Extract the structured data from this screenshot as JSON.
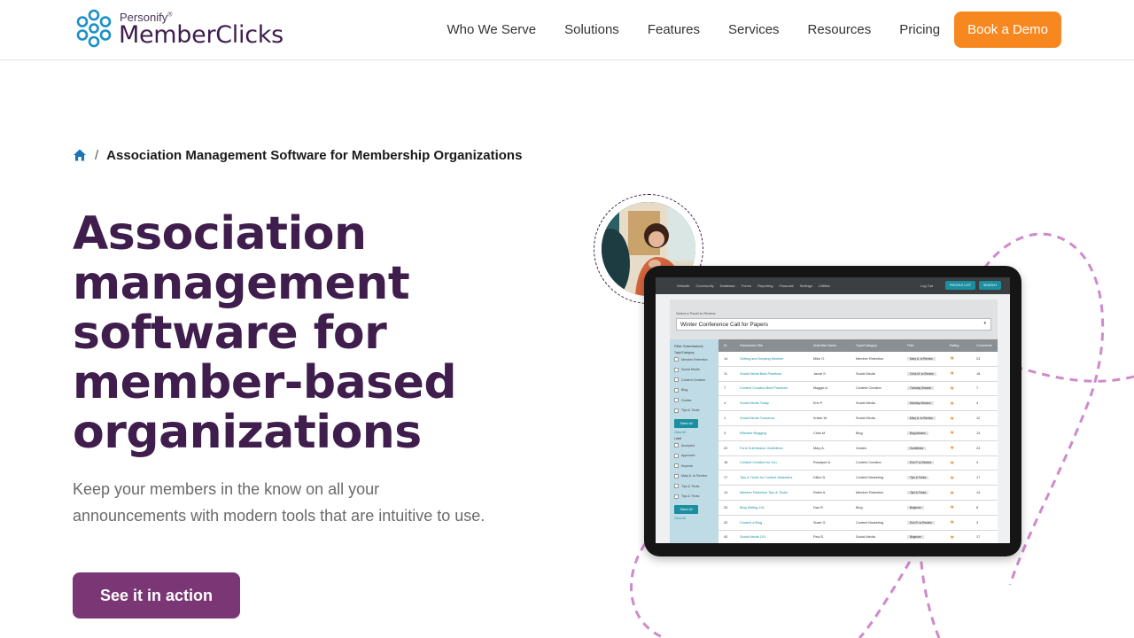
{
  "header": {
    "logo": {
      "small": "Personify",
      "mark": "®",
      "big": "MemberClicks"
    },
    "nav": [
      "Who We Serve",
      "Solutions",
      "Features",
      "Services",
      "Resources",
      "Pricing"
    ],
    "demo_label": "Book a Demo"
  },
  "breadcrumb": {
    "separator": "/",
    "current": "Association Management Software for Membership Organizations"
  },
  "hero": {
    "title_lines": [
      "Association",
      "management",
      "software for",
      "member-based",
      "organizations"
    ],
    "subtitle": "Keep your members in the know on all your announcements with modern tools that are intuitive to use.",
    "cta_label": "See it in action"
  },
  "tablet": {
    "topnav": [
      "Website",
      "Community",
      "Database",
      "Forms",
      "Reporting",
      "Financial",
      "Settings",
      "Utilities"
    ],
    "logout": "Log Out",
    "btn1": "PROFILE LIST",
    "btn2": "SEARCH",
    "select_label": "Select a Panel to Review",
    "select_value": "Winter Conference Call for Papers",
    "filter_head": "Filter Submissions",
    "filter_sub1": "Topic/Category",
    "filters1": [
      "Member Retention",
      "Social Media",
      "Content Creation",
      "Blog",
      "Guides",
      "Tips & Tricks"
    ],
    "select_all": "Select All",
    "clear_all": "Clear All",
    "filter_sub2": "Label",
    "filters2": [
      "Accepted",
      "Approved",
      "Keynote",
      "Mary A. to Review",
      "Tips & Tricks",
      "Tips & Tricks"
    ],
    "columns": [
      "ID",
      "Submission Title",
      "Submitter Name",
      "Topic/Category",
      "Filter",
      "Rating",
      "Comments"
    ],
    "rows": [
      [
        "14",
        "Getting and Keeping Member",
        "Mike O.",
        "Member Retention",
        "Mary A. to Review",
        "★",
        "23"
      ],
      [
        "11",
        "Social Media Best Practices",
        "Jacob S.",
        "Social Media",
        "Chris M. to Review",
        "★",
        "18"
      ],
      [
        "7",
        "Content Creation Best Practices",
        "Maggie A.",
        "Content Creation",
        "Tuesday Session",
        "★",
        "7"
      ],
      [
        "4",
        "Social Media Today",
        "Erin P.",
        "Social Media",
        "Monday Session",
        "★",
        "4"
      ],
      [
        "1",
        "Social Media Tomorrow",
        "Kristin W.",
        "Social Media",
        "Mary A. to Review",
        "★",
        "12"
      ],
      [
        "3",
        "Effective Blogging",
        "Chris M.",
        "Blog",
        "Blog Articles",
        "★",
        "13"
      ],
      [
        "22",
        "Form Submission Guidelines",
        "Mary A.",
        "Guides",
        "Guidelines",
        "★",
        "24"
      ],
      [
        "18",
        "Content Creation for You",
        "Rosalyce A.",
        "Content Creation",
        "Erin P. to Review",
        "★",
        "4"
      ],
      [
        "17",
        "Tips & Tricks for Content Marketers",
        "Dillon D.",
        "Content Marketing",
        "Tips & Tricks",
        "★",
        "17"
      ],
      [
        "14",
        "Member Retention Tips & Tricks",
        "Robin A.",
        "Member Retention",
        "Tips & Tricks",
        "★",
        "14"
      ],
      [
        "33",
        "Blog Writing 101",
        "Dan R.",
        "Blog",
        "Beginner",
        "★",
        "8"
      ],
      [
        "32",
        "Content a Blog",
        "Suzie G.",
        "Content Marketing",
        "Erin R. to Review",
        "★",
        "3"
      ],
      [
        "40",
        "Social Media 101",
        "Paul S.",
        "Social Media",
        "Beginner",
        "★",
        "17"
      ]
    ]
  },
  "colors": {
    "brand_purple": "#3f1d4d",
    "cta_purple": "#7b3676",
    "orange": "#f7881f",
    "accent_blue": "#1b8fc6",
    "dashed_pink": "#cf8acb"
  }
}
